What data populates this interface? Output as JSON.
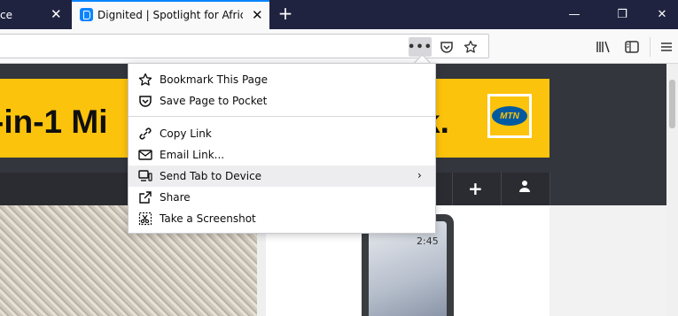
{
  "tabs": [
    {
      "title": "ce"
    },
    {
      "title": "Dignited | Spotlight for African"
    }
  ],
  "new_tab_label": "+",
  "window_buttons": {
    "minimize": "—",
    "maximize": "❐",
    "close": "✕"
  },
  "urlbar": {
    "text": ""
  },
  "page_actions_label": "•••",
  "banner": {
    "left_text": "-in-1 Mi",
    "right_text": "k.",
    "logo_text": "MTN"
  },
  "phone_time": "2:45",
  "menu": {
    "items": [
      {
        "label": "Bookmark This Page",
        "icon": "star-icon"
      },
      {
        "label": "Save Page to Pocket",
        "icon": "pocket-icon"
      },
      {
        "label": "Copy Link",
        "icon": "link-icon"
      },
      {
        "label": "Email Link...",
        "icon": "mail-icon"
      },
      {
        "label": "Send Tab to Device",
        "icon": "device-icon",
        "submenu": "›"
      },
      {
        "label": "Share",
        "icon": "share-icon"
      },
      {
        "label": "Take a Screenshot",
        "icon": "screenshot-icon"
      }
    ]
  },
  "colors": {
    "accent": "#0a84ff",
    "tabstrip": "#202340",
    "banner": "#fcc30d",
    "dark": "#33363d"
  }
}
